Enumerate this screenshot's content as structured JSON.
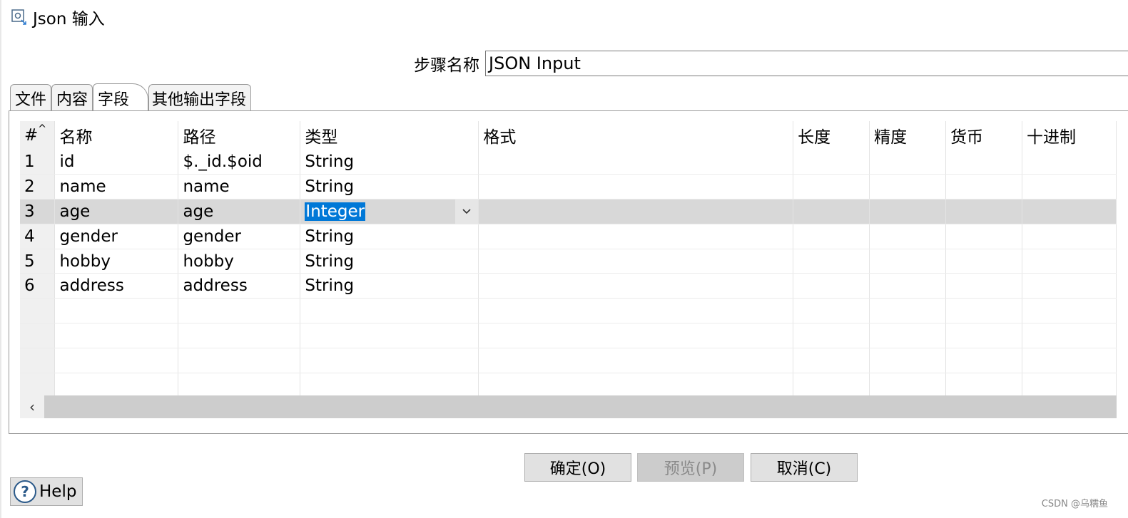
{
  "window": {
    "title": "Json 输入",
    "icon": "json-input-icon"
  },
  "stepname": {
    "label": "步骤名称",
    "value": "JSON Input"
  },
  "tabs": [
    {
      "label": "文件",
      "active": false
    },
    {
      "label": "内容",
      "active": false
    },
    {
      "label": "字段",
      "active": true
    },
    {
      "label": "其他输出字段",
      "active": false
    }
  ],
  "grid": {
    "columns": [
      "#",
      "名称",
      "路径",
      "类型",
      "格式",
      "长度",
      "精度",
      "货币",
      "十进制"
    ],
    "rows": [
      {
        "num": "1",
        "name": "id",
        "path": "$._id.$oid",
        "type": "String"
      },
      {
        "num": "2",
        "name": "name",
        "path": "name",
        "type": "String"
      },
      {
        "num": "3",
        "name": "age",
        "path": "age",
        "type": "Integer"
      },
      {
        "num": "4",
        "name": "gender",
        "path": "gender",
        "type": "String"
      },
      {
        "num": "5",
        "name": "hobby",
        "path": "hobby",
        "type": "String"
      },
      {
        "num": "6",
        "name": "address",
        "path": "address",
        "type": "String"
      }
    ],
    "selected_row": "3"
  },
  "buttons": {
    "ok": "确定(O)",
    "preview": "预览(P)",
    "cancel": "取消(C)",
    "help": "Help"
  },
  "watermark": "CSDN @乌糯鱼",
  "colors": {
    "selection": "#0078d7",
    "selected_row": "#d8d8d8"
  }
}
